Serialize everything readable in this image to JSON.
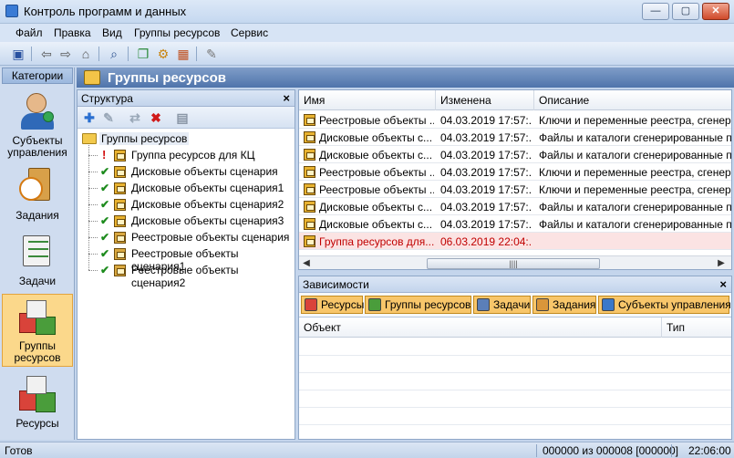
{
  "window": {
    "title": "Контроль программ и данных",
    "buttons": {
      "minimize": "—",
      "maximize": "▢",
      "close": "✕"
    }
  },
  "menu": [
    "Файл",
    "Правка",
    "Вид",
    "Группы ресурсов",
    "Сервис"
  ],
  "toolbar": {
    "icons": [
      "save-icon",
      "back-icon",
      "forward-icon",
      "home-icon",
      "search-icon",
      "copy-icon",
      "gear-icon",
      "calculator-icon",
      "wrench-icon"
    ]
  },
  "categories": {
    "header": "Категории",
    "items": [
      {
        "label": "Субъекты управления",
        "icon": "users-icon"
      },
      {
        "label": "Задания",
        "icon": "clock-clipboard-icon"
      },
      {
        "label": "Задачи",
        "icon": "tasks-icon"
      },
      {
        "label": "Группы ресурсов",
        "icon": "resource-groups-icon",
        "selected": true
      },
      {
        "label": "Ресурсы",
        "icon": "resources-icon"
      }
    ]
  },
  "main_title": "Группы ресурсов",
  "structure": {
    "header": "Структура",
    "close": "×",
    "toolbar_icons": [
      "add-icon",
      "edit-icon",
      "link-icon",
      "delete-icon",
      "properties-icon"
    ],
    "root": "Группы ресурсов",
    "items": [
      {
        "label": "Группа ресурсов для КЦ",
        "status": "error"
      },
      {
        "label": "Дисковые объекты сценария",
        "status": "ok"
      },
      {
        "label": "Дисковые объекты сценария1",
        "status": "ok"
      },
      {
        "label": "Дисковые объекты сценария2",
        "status": "ok"
      },
      {
        "label": "Дисковые объекты сценария3",
        "status": "ok"
      },
      {
        "label": "Реестровые объекты сценария",
        "status": "ok"
      },
      {
        "label": "Реестровые объекты сценария1",
        "status": "ok"
      },
      {
        "label": "Реестровые объекты сценария2",
        "status": "ok"
      }
    ],
    "status_marks": {
      "ok": "✔",
      "error": "!"
    }
  },
  "grid": {
    "columns": [
      "Имя",
      "Изменена",
      "Описание"
    ],
    "rows": [
      {
        "name": "Реестровые объекты ...",
        "changed": "04.03.2019 17:57:...",
        "desc": "Ключи и переменные реестра, сгенер"
      },
      {
        "name": "Дисковые объекты с...",
        "changed": "04.03.2019 17:57:...",
        "desc": "Файлы и каталоги сгенерированные п"
      },
      {
        "name": "Дисковые объекты с...",
        "changed": "04.03.2019 17:57:...",
        "desc": "Файлы и каталоги сгенерированные п"
      },
      {
        "name": "Реестровые объекты ...",
        "changed": "04.03.2019 17:57:...",
        "desc": "Ключи и переменные реестра, сгенер"
      },
      {
        "name": "Реестровые объекты ...",
        "changed": "04.03.2019 17:57:...",
        "desc": "Ключи и переменные реестра, сгенер"
      },
      {
        "name": "Дисковые объекты с...",
        "changed": "04.03.2019 17:57:...",
        "desc": "Файлы и каталоги сгенерированные п"
      },
      {
        "name": "Дисковые объекты с...",
        "changed": "04.03.2019 17:57:...",
        "desc": "Файлы и каталоги сгенерированные п"
      },
      {
        "name": "Группа ресурсов для...",
        "changed": "06.03.2019 22:04:...",
        "desc": "",
        "error": true
      }
    ],
    "scroll": {
      "left": "◀",
      "right": "▶",
      "grip": "||||"
    }
  },
  "dependencies": {
    "header": "Зависимости",
    "close": "×",
    "tabs": [
      {
        "label": "Ресурсы",
        "color": "#d9433a"
      },
      {
        "label": "Группы ресурсов",
        "color": "#4a9d3b"
      },
      {
        "label": "Задачи",
        "color": "#5b7fb8"
      },
      {
        "label": "Задания",
        "color": "#d9963a"
      },
      {
        "label": "Субъекты управления",
        "color": "#3a78c9"
      }
    ],
    "columns": [
      "Объект",
      "Тип"
    ]
  },
  "status": {
    "left": "Готов",
    "counter": "000000 из 000008 [000000]",
    "time": "22:06:00"
  }
}
